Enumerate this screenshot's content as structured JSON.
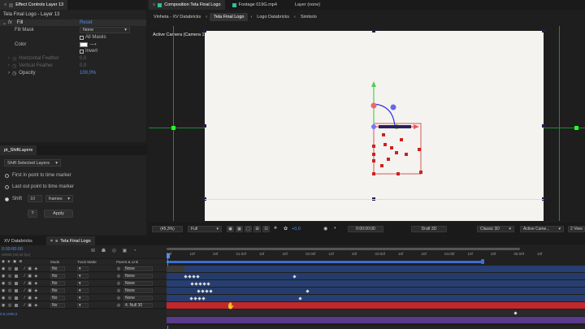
{
  "effect_controls": {
    "tab_label": "Effect Controls Layer 13",
    "layer_title": "Tela Final Logo - Layer 13",
    "effect_name": "Fill",
    "reset_label": "Reset",
    "fill_mask_label": "Fill Mask",
    "fill_mask_value": "None",
    "all_masks_label": "All Masks",
    "color_label": "Color",
    "invert_label": "Invert",
    "horizontal_feather_label": "Horizontal Feather",
    "horizontal_feather_value": "0,0",
    "vertical_feather_label": "Vertical Feather",
    "vertical_feather_value": "0,0",
    "opacity_label": "Opacity",
    "opacity_value": "100,0%",
    "fill_color": "#ffffff"
  },
  "shift_layers": {
    "tab_label": "pt_ShiftLayers",
    "mode_value": "Shift Selected Layers",
    "option_first": "First in point to time marker",
    "option_last": "Last out point to time marker",
    "option_shift": "Shift",
    "shift_amount": "10",
    "shift_unit": "frames",
    "help_label": "?",
    "apply_label": "Apply"
  },
  "comp_tabs": {
    "composition_tab": "Composition Tela Final Logo",
    "footage_tab": "Footage 019G.mp4",
    "layer_tab": "Layer (none)"
  },
  "breadcrumbs": [
    "Vinheta - XV Databricks",
    "Tela Final Logo",
    "Logo Databricks",
    "Simbolo"
  ],
  "viewer": {
    "camera_label": "Active Camera (Camera 1)"
  },
  "viewer_controls": {
    "zoom": "(45,3%)",
    "resolution": "Full",
    "exposure": "+0,0",
    "timecode": "0:00:00:00",
    "draft": "Draft 3D",
    "renderer": "Classic 3D",
    "camera": "Active Came...",
    "views": "2 View"
  },
  "timeline": {
    "tab_prev": "XV Databricks",
    "tab_current": "Tela Final Logo",
    "current_time": "0:00:00:00",
    "frame_info": "00000 (30,00 fps)",
    "coords": "0,0,1080,0",
    "columns": {
      "mode": "Mode",
      "trkmat": "Track Matte",
      "parent": "Parent & Link"
    },
    "ruler_ticks": [
      "00f",
      "10f",
      "20f",
      "01:00f",
      "10f",
      "20f",
      "02:00f",
      "10f",
      "20f",
      "03:00f",
      "10f",
      "20f",
      "04:00f",
      "10f",
      "20f",
      "05:00f",
      "10f"
    ],
    "layers": [
      {
        "mode": "No",
        "parent": "None"
      },
      {
        "mode": "No",
        "parent": "None"
      },
      {
        "mode": "No",
        "parent": "None"
      },
      {
        "mode": "No",
        "parent": "None"
      },
      {
        "mode": "No",
        "parent": "None"
      },
      {
        "mode": "No",
        "parent": "4. Null 30"
      }
    ]
  },
  "colors": {
    "accent_blue": "#3a6fd6",
    "red_layer": "#c0282c",
    "purple_layer": "#5a3a8a",
    "teal_label": "#2fbfa0"
  }
}
